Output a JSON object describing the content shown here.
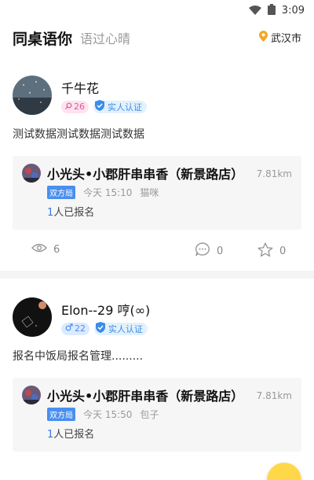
{
  "status_bar": {
    "time": "3:09",
    "icons": [
      "wifi-icon",
      "battery-icon"
    ]
  },
  "header": {
    "title": "同桌语你",
    "subtitle": "语过心晴",
    "location": "武汉市",
    "location_icon": "location-pin-icon",
    "accent_color": "#f5a623"
  },
  "posts": [
    {
      "user": {
        "name": "千牛花",
        "gender": "female",
        "age": "26",
        "verified_label": "实人认证"
      },
      "text": "测试数据测试数据测试数据",
      "event": {
        "title": "小光头•小郡肝串串香（新景路店）",
        "distance": "7.81km",
        "tag": "双方局",
        "time": "今天 15:10",
        "pet": "猫咪",
        "signup_count": "1",
        "signup_suffix": "人已报名"
      },
      "stats": {
        "views": "6",
        "comments": "0",
        "likes": "0"
      }
    },
    {
      "user": {
        "name": "Elon--29 哼(∞)",
        "gender": "male",
        "age": "22",
        "verified_label": "实人认证"
      },
      "text": "报名中饭局报名管理.........",
      "event": {
        "title": "小光头•小郡肝串串香（新景路店）",
        "distance": "7.81km",
        "tag": "双方局",
        "time": "今天 15:50",
        "pet": "包子",
        "signup_count": "1",
        "signup_suffix": "人已报名"
      },
      "stats": {
        "views": "",
        "comments": "",
        "likes": ""
      }
    }
  ],
  "colors": {
    "female": "#e5579b",
    "male": "#4b8ff0",
    "verified": "#3a8de8",
    "fab": "#ffd84a"
  }
}
